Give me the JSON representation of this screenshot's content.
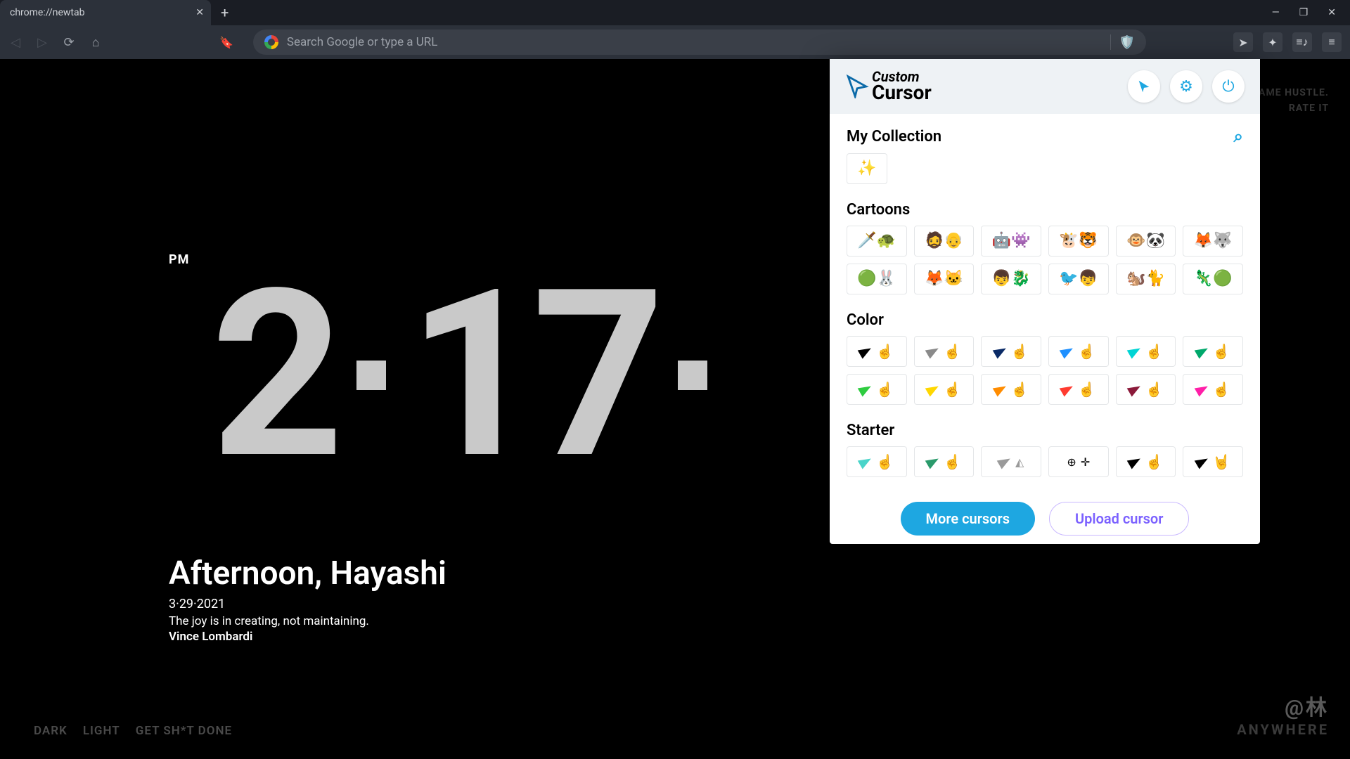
{
  "browser": {
    "tab_title": "chrome://newtab",
    "address_placeholder": "Search Google or type a URL"
  },
  "page": {
    "meridiem": "PM",
    "hour": "2",
    "minute": "17",
    "greeting": "Afternoon, Hayashi",
    "date": "3·29·2021",
    "quote": "The joy is in creating, not maintaining.",
    "author": "Vince Lombardi",
    "promo_line1": "SAME HUSTLE.",
    "promo_line2": "RATE IT",
    "watermark_handle": "@林",
    "watermark_line2": "ANYWHERE",
    "theme_dark": "DARK",
    "theme_light": "LIGHT",
    "theme_hustle": "GET SH*T DONE"
  },
  "popup": {
    "logo_top": "Custom",
    "logo_bottom": "Cursor",
    "my_collection_title": "My Collection",
    "my_collection_items": [
      "✨"
    ],
    "sections": {
      "cartoons": {
        "title": "Cartoons",
        "items": [
          "🗡️🐢",
          "🧔👴",
          "🤖👾",
          "🐮🐯",
          "🐵🐼",
          "🦊🐺",
          "🟢🐰",
          "🦊🐱",
          "👦🐉",
          "🐦👦",
          "🐿️🐈",
          "🦎🟢"
        ]
      },
      "color": {
        "title": "Color",
        "items": [
          {
            "c": "#000000"
          },
          {
            "c": "#8a8a8a"
          },
          {
            "c": "#0a2a66"
          },
          {
            "c": "#1e90ff"
          },
          {
            "c": "#00d4d4"
          },
          {
            "c": "#00a86b"
          },
          {
            "c": "#2ecc40"
          },
          {
            "c": "#ffd700"
          },
          {
            "c": "#ff8c00"
          },
          {
            "c": "#ff3b30"
          },
          {
            "c": "#8b1a3a"
          },
          {
            "c": "#ff1fa8"
          }
        ]
      },
      "starter": {
        "title": "Starter",
        "items": [
          "teal",
          "outline",
          "poly",
          "target",
          "thin",
          "rock"
        ]
      }
    },
    "more_label": "More cursors",
    "upload_label": "Upload cursor"
  }
}
